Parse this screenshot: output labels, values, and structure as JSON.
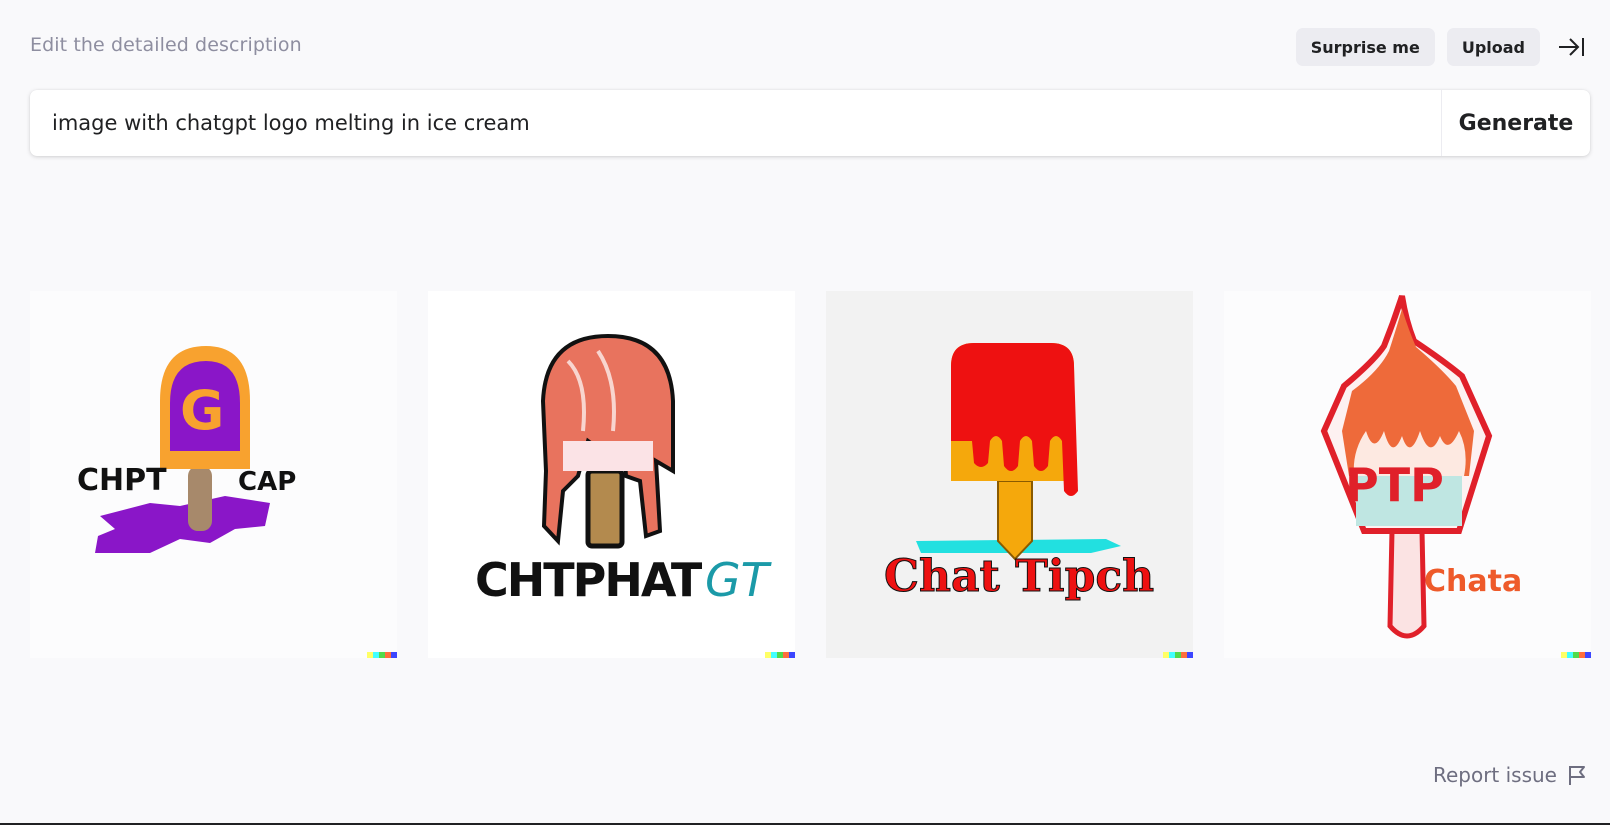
{
  "header": {
    "label": "Edit the detailed description",
    "surprise_label": "Surprise me",
    "upload_label": "Upload"
  },
  "prompt": {
    "value": "image with chatgpt logo melting in ice cream",
    "generate_label": "Generate"
  },
  "gallery": {
    "images": [
      {
        "texts": [
          "CHPT",
          "CAP"
        ],
        "letter": "G"
      },
      {
        "texts": [
          "CHTPHAT",
          "GT"
        ]
      },
      {
        "texts": [
          "Chat Tipch"
        ]
      },
      {
        "texts": [
          "PTP",
          "Chata"
        ]
      }
    ],
    "watermark_colors": [
      "#ffff66",
      "#42ffff",
      "#51da4c",
      "#ff6e3c",
      "#3c46ff"
    ]
  },
  "footer": {
    "report_label": "Report issue"
  }
}
